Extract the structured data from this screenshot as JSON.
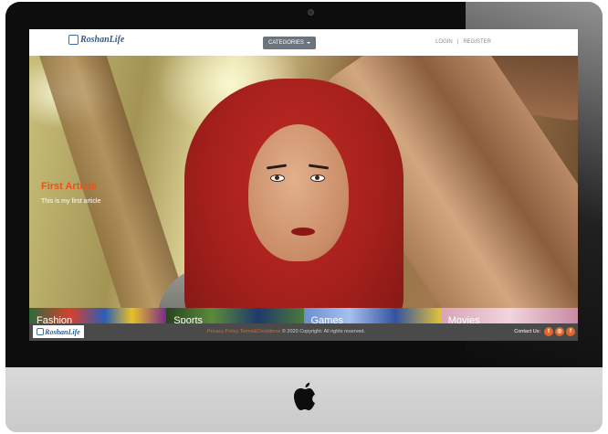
{
  "header": {
    "brand": "RoshanLife",
    "categories_button": "CATEGORIES",
    "login": "LOGIN",
    "separator": "|",
    "register": "REGISTER"
  },
  "hero": {
    "title": "First Article",
    "subtitle": "This is my first article"
  },
  "categories": [
    {
      "label": "Fashion"
    },
    {
      "label": "Sports"
    },
    {
      "label": "Games"
    },
    {
      "label": "Movies"
    }
  ],
  "footer": {
    "brand": "RoshanLife",
    "privacy": "Privacy Policy",
    "terms": "Terms&Conditions",
    "copyright": "© 2020 Copyright: All rights reserved.",
    "contact": "Contact Us:",
    "social_icons": [
      "twitter-icon",
      "instagram-icon",
      "facebook-icon"
    ]
  },
  "colors": {
    "accent": "#e0662a",
    "footer_bg": "#4a4a4a",
    "button_bg": "#6c757d",
    "brand": "#2f5d94"
  }
}
